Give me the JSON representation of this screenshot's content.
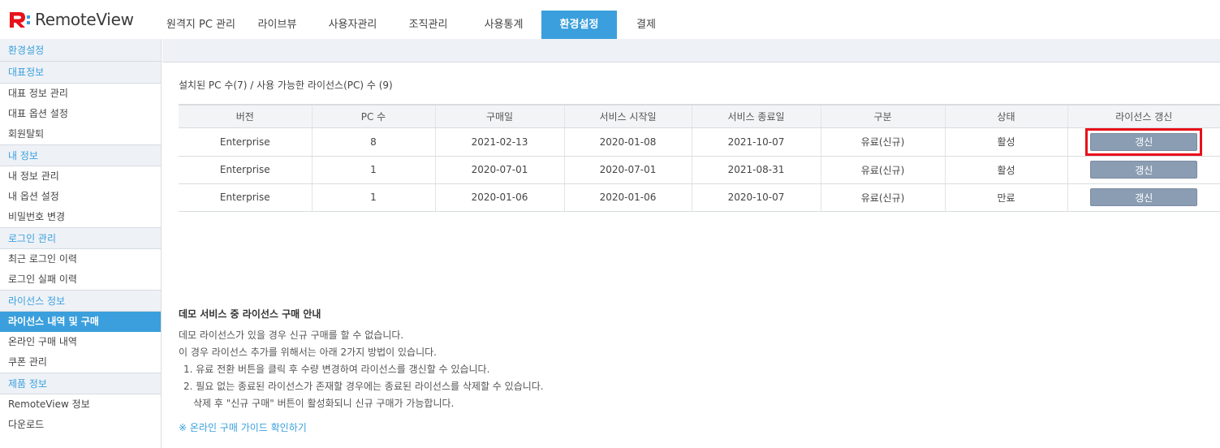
{
  "brand": {
    "name": "RemoteView",
    "accent": "#e8101a",
    "primary": "#3a9fdc"
  },
  "nav": {
    "tabs": [
      {
        "label": "원격지 PC 관리",
        "active": false
      },
      {
        "label": "라이브뷰",
        "active": false
      },
      {
        "label": "사용자관리",
        "active": false
      },
      {
        "label": "조직관리",
        "active": false
      },
      {
        "label": "사용통계",
        "active": false
      },
      {
        "label": "환경설정",
        "active": true
      },
      {
        "label": "결제",
        "active": false
      }
    ]
  },
  "sidebar": {
    "title": "환경설정",
    "groups": [
      {
        "header": "대표정보",
        "items": [
          "대표 정보 관리",
          "대표 옵션 설정",
          "회원탈퇴"
        ]
      },
      {
        "header": "내 정보",
        "items": [
          "내 정보 관리",
          "내 옵션 설정",
          "비밀번호 변경"
        ]
      },
      {
        "header": "로그인 관리",
        "items": [
          "최근 로그인 이력",
          "로그인 실패 이력"
        ]
      },
      {
        "header": "라이선스 정보",
        "items": [
          "라이선스 내역 및 구매",
          "온라인 구매 내역",
          "쿠폰 관리"
        ],
        "active_index": 0
      },
      {
        "header": "제품 정보",
        "items": [
          "RemoteView 정보",
          "다운로드"
        ]
      }
    ]
  },
  "main": {
    "summary": "설치된 PC 수(7) / 사용 가능한 라이선스(PC) 수 (9)",
    "table": {
      "columns": [
        "버전",
        "PC 수",
        "구매일",
        "서비스 시작일",
        "서비스 종료일",
        "구분",
        "상태",
        "라이선스 갱신"
      ],
      "rows": [
        {
          "version": "Enterprise",
          "pc_count": "8",
          "purchase_date": "2021-02-13",
          "start_date": "2020-01-08",
          "end_date": "2021-10-07",
          "type": "유료(신규)",
          "status": "활성",
          "renew_label": "갱신",
          "highlighted": true
        },
        {
          "version": "Enterprise",
          "pc_count": "1",
          "purchase_date": "2020-07-01",
          "start_date": "2020-07-01",
          "end_date": "2021-08-31",
          "type": "유료(신규)",
          "status": "활성",
          "renew_label": "갱신",
          "highlighted": false
        },
        {
          "version": "Enterprise",
          "pc_count": "1",
          "purchase_date": "2020-01-06",
          "start_date": "2020-01-06",
          "end_date": "2020-10-07",
          "type": "유료(신규)",
          "status": "만료",
          "renew_label": "갱신",
          "highlighted": false
        }
      ]
    },
    "notice": {
      "title": "데모 서비스 중 라이선스 구매 안내",
      "lines": [
        "데모 라이선스가 있을 경우 신규 구매를 할 수 없습니다.",
        "이 경우 라이선스 추가를 위해서는 아래 2가지 방법이 있습니다.",
        "1. 유료 전환 버튼을 클릭 후 수량 변경하여 라이선스를 갱신할 수 있습니다.",
        "2. 필요 없는 종료된 라이선스가 존재할 경우에는 종료된 라이선스를 삭제할 수 있습니다.",
        "삭제 후 \"신규 구매\" 버튼이 활성화되니 신규 구매가 가능합니다."
      ]
    },
    "guide_link": "※ 온라인 구매 가이드 확인하기"
  }
}
